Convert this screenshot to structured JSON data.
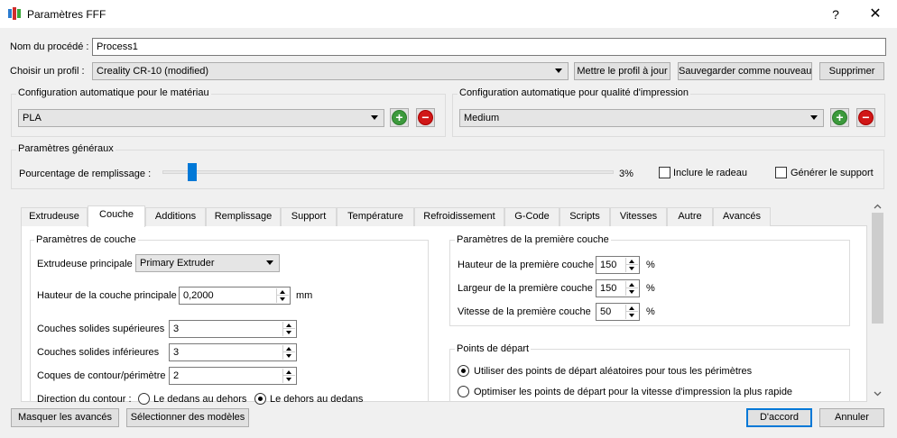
{
  "window": {
    "title": "Paramètres FFF",
    "help_label": "?",
    "close_label": "✕"
  },
  "process": {
    "label": "Nom du procédé :",
    "value": "Process1"
  },
  "profile": {
    "label": "Choisir un profil :",
    "selected": "Creality CR-10 (modified)",
    "update_button": "Mettre le profil à jour",
    "save_new_button": "Sauvegarder comme nouveau",
    "delete_button": "Supprimer"
  },
  "material_auto": {
    "title": "Configuration automatique pour le matériau",
    "selected": "PLA"
  },
  "quality_auto": {
    "title": "Configuration automatique pour qualité d'impression",
    "selected": "Medium"
  },
  "general": {
    "title": "Paramètres généraux",
    "infill_label": "Pourcentage de remplissage :",
    "infill_value_text": "3%",
    "infill_fraction": 0.03,
    "raft_label": "Inclure le radeau",
    "raft_checked": false,
    "support_label": "Générer le support",
    "support_checked": false
  },
  "tabs": [
    {
      "label": "Extrudeuse",
      "active": false
    },
    {
      "label": "Couche",
      "active": true
    },
    {
      "label": "Additions",
      "active": false
    },
    {
      "label": "Remplissage",
      "active": false
    },
    {
      "label": "Support",
      "active": false
    },
    {
      "label": "Température",
      "active": false
    },
    {
      "label": "Refroidissement",
      "active": false
    },
    {
      "label": "G-Code",
      "active": false
    },
    {
      "label": "Scripts",
      "active": false
    },
    {
      "label": "Vitesses",
      "active": false
    },
    {
      "label": "Autre",
      "active": false
    },
    {
      "label": "Avancés",
      "active": false
    }
  ],
  "layer": {
    "title": "Paramètres de couche",
    "main_extruder_label": "Extrudeuse principale",
    "main_extruder_value": "Primary Extruder",
    "layer_height_label": "Hauteur de la couche principale",
    "layer_height_value": "0,2000",
    "layer_height_unit": "mm",
    "top_solid_label": "Couches solides supérieures",
    "top_solid_value": "3",
    "bottom_solid_label": "Couches solides inférieures",
    "bottom_solid_value": "3",
    "perimeter_label": "Coques de contour/périmètre",
    "perimeter_value": "2",
    "direction_label": "Direction du contour :",
    "direction_inside_out": "Le dedans au dehors",
    "direction_outside_in": "Le dehors au dedans"
  },
  "first_layer": {
    "title": "Paramètres de la première couche",
    "height_label": "Hauteur de la première couche",
    "height_value": "150",
    "width_label": "Largeur de la première couche",
    "width_value": "150",
    "speed_label": "Vitesse de la première couche",
    "speed_value": "50",
    "unit": "%"
  },
  "start_points": {
    "title": "Points de départ",
    "random_label": "Utiliser des points de départ aléatoires pour tous les périmètres",
    "optimize_label": "Optimiser les points de départ pour la vitesse d'impression la plus rapide"
  },
  "footer": {
    "hide_advanced": "Masquer les avancés",
    "select_models": "Sélectionner des modèles",
    "ok": "D'accord",
    "cancel": "Annuler"
  },
  "colors": {
    "accent": "#0078d7",
    "add": "#3c9a3c",
    "remove": "#d01717"
  }
}
